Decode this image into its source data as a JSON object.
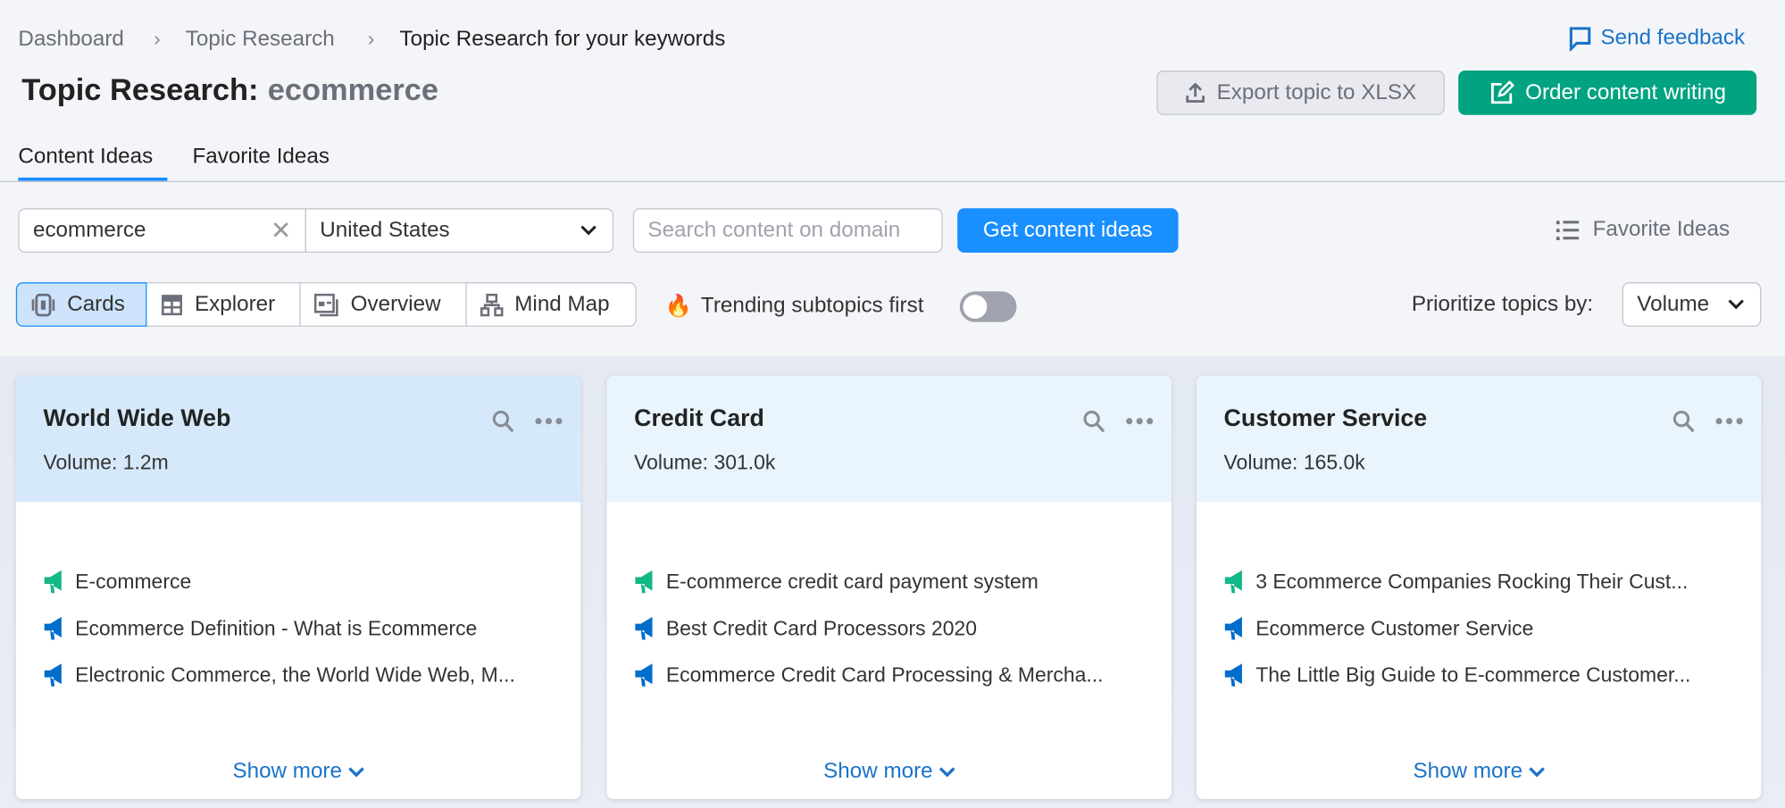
{
  "breadcrumb": [
    "Dashboard",
    "Topic Research",
    "Topic Research for your keywords"
  ],
  "feedback": "Send feedback",
  "title": {
    "label": "Topic Research:",
    "keyword": "ecommerce"
  },
  "actions": {
    "export": "Export topic to XLSX",
    "order": "Order content writing"
  },
  "tabs": [
    {
      "label": "Content Ideas",
      "active": true
    },
    {
      "label": "Favorite Ideas",
      "active": false
    }
  ],
  "search": {
    "keyword": "ecommerce",
    "country": "United States",
    "domain_placeholder": "Search content on domain",
    "submit": "Get content ideas",
    "favorites": "Favorite Ideas"
  },
  "views": [
    {
      "label": "Cards",
      "icon": "cards-icon",
      "active": true
    },
    {
      "label": "Explorer",
      "icon": "table-icon"
    },
    {
      "label": "Overview",
      "icon": "overview-icon"
    },
    {
      "label": "Mind Map",
      "icon": "mindmap-icon"
    }
  ],
  "trending": {
    "label": "Trending subtopics first",
    "enabled": false
  },
  "prioritize": {
    "label": "Prioritize topics by:",
    "value": "Volume"
  },
  "colors": {
    "accent": "#1a8fff",
    "green": "#02a380",
    "link": "#1b73c8",
    "megaphone_green": "#13b887",
    "megaphone_blue": "#006dca"
  },
  "cards": [
    {
      "title": "World Wide Web",
      "volume_label": "Volume:",
      "volume": "1.2m",
      "items": [
        {
          "text": "E-commerce",
          "trend": "green"
        },
        {
          "text": "Ecommerce Definition - What is Ecommerce",
          "trend": "blue"
        },
        {
          "text": "Electronic Commerce, the World Wide Web, M...",
          "trend": "blue"
        }
      ],
      "more": "Show more"
    },
    {
      "title": "Credit Card",
      "volume_label": "Volume:",
      "volume": "301.0k",
      "items": [
        {
          "text": "E-commerce credit card payment system",
          "trend": "green"
        },
        {
          "text": "Best Credit Card Processors 2020",
          "trend": "blue"
        },
        {
          "text": "Ecommerce Credit Card Processing & Mercha...",
          "trend": "blue"
        }
      ],
      "more": "Show more"
    },
    {
      "title": "Customer Service",
      "volume_label": "Volume:",
      "volume": "165.0k",
      "items": [
        {
          "text": "3 Ecommerce Companies Rocking Their Cust...",
          "trend": "green"
        },
        {
          "text": "Ecommerce Customer Service",
          "trend": "blue"
        },
        {
          "text": "The Little Big Guide to E-commerce Customer...",
          "trend": "blue"
        }
      ],
      "more": "Show more"
    }
  ]
}
